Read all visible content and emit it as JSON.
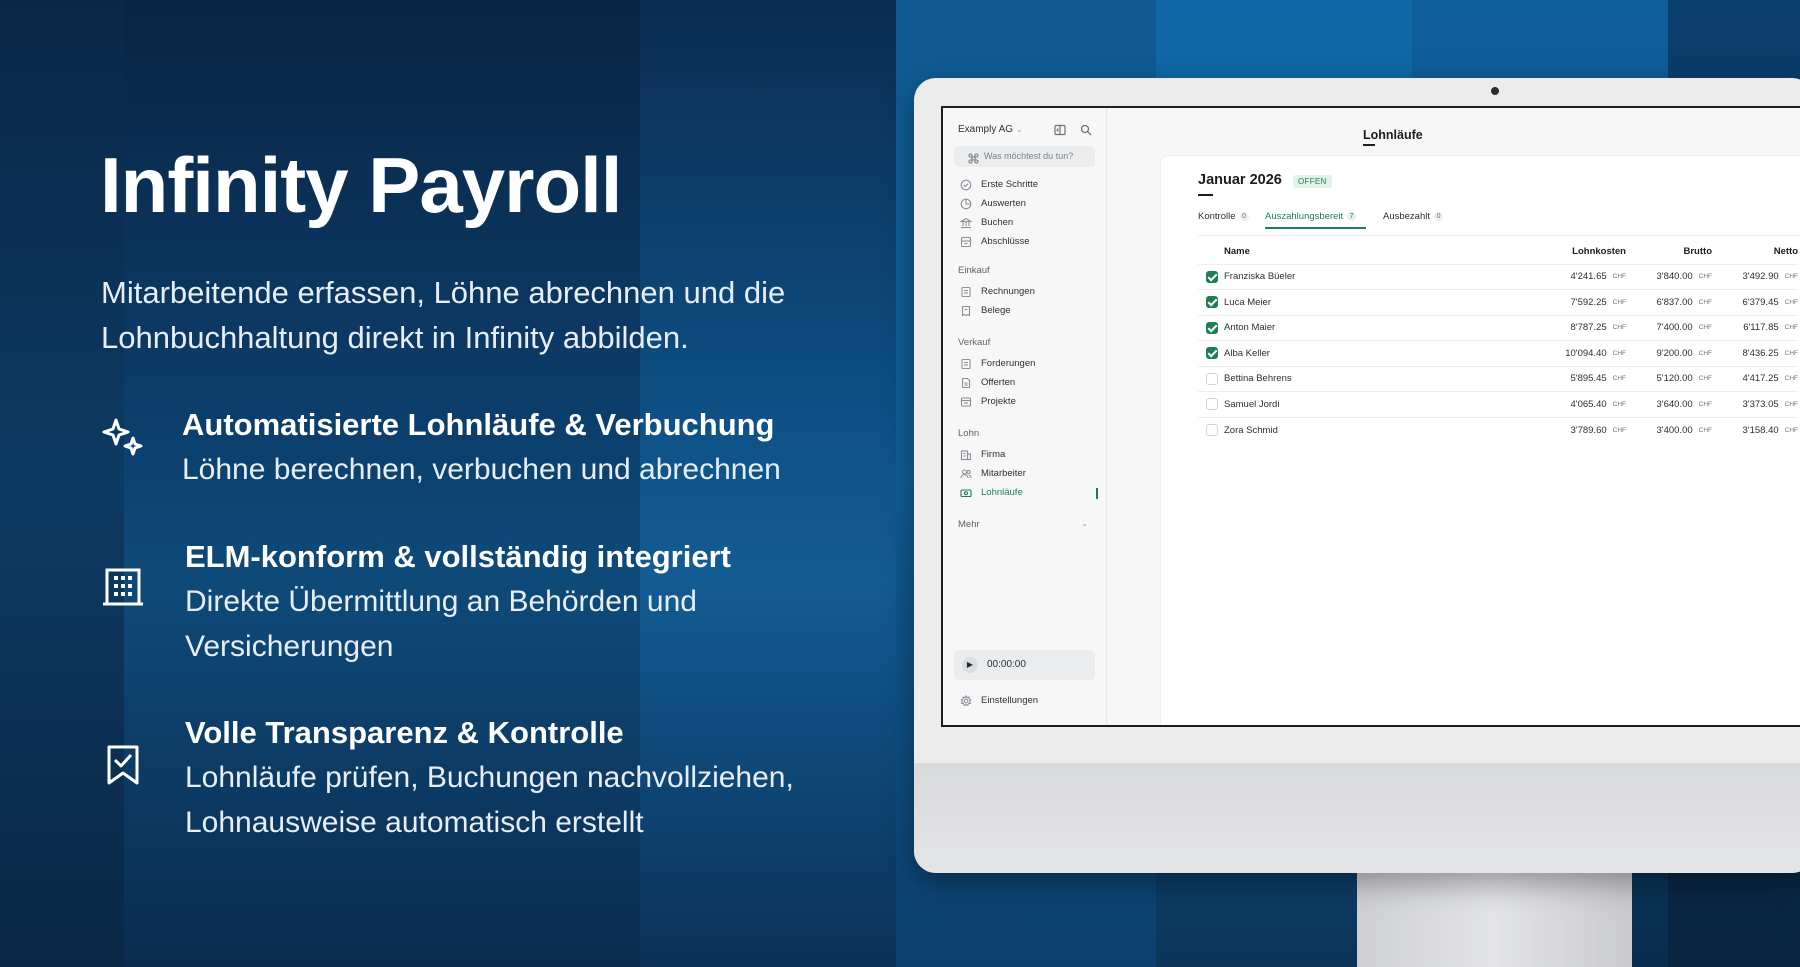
{
  "hero": {
    "title": "Infinity Payroll",
    "subtitle": "Mitarbeitende erfassen, Löhne abrechnen und die Lohnbuchhaltung direkt in Infinity abbilden."
  },
  "features": [
    {
      "icon": "sparkles-icon",
      "heading": "Automatisierte Lohnläufe & Verbuchung",
      "description": "Löhne berechnen, verbuchen und abrechnen"
    },
    {
      "icon": "building-icon",
      "heading": "ELM-konform & vollständig integriert",
      "description": "Direkte Übermittlung an Behörden und Versicherungen"
    },
    {
      "icon": "bookmark-check-icon",
      "heading": "Volle Transparenz & Kontrolle",
      "description": "Lohnläufe prüfen, Buchungen nachvollziehen, Lohnausweise automatisch erstellt"
    }
  ],
  "app": {
    "company": "Examply AG",
    "ask_placeholder": "Was möchtest du tun?",
    "nav_main": [
      {
        "label": "Erste Schritte",
        "icon": "check-circle-icon"
      },
      {
        "label": "Auswerten",
        "icon": "chart-icon"
      },
      {
        "label": "Buchen",
        "icon": "bank-icon"
      },
      {
        "label": "Abschlüsse",
        "icon": "archive-icon"
      }
    ],
    "sections": [
      {
        "title": "Einkauf",
        "items": [
          {
            "label": "Rechnungen",
            "icon": "invoice-icon"
          },
          {
            "label": "Belege",
            "icon": "receipt-icon"
          }
        ]
      },
      {
        "title": "Verkauf",
        "items": [
          {
            "label": "Forderungen",
            "icon": "invoice-icon"
          },
          {
            "label": "Offerten",
            "icon": "document-icon"
          },
          {
            "label": "Projekte",
            "icon": "folder-icon"
          }
        ]
      },
      {
        "title": "Lohn",
        "items": [
          {
            "label": "Firma",
            "icon": "building-icon"
          },
          {
            "label": "Mitarbeiter",
            "icon": "users-icon"
          },
          {
            "label": "Lohnläufe",
            "icon": "money-icon"
          }
        ]
      }
    ],
    "more_label": "Mehr",
    "timer": "00:00:00",
    "settings_label": "Einstellungen",
    "page_title": "Lohnläufe",
    "period": "Januar 2026",
    "period_status": "OFFEN",
    "tabs": [
      {
        "label": "Kontrolle",
        "count": "0"
      },
      {
        "label": "Auszahlungsbereit",
        "count": "7"
      },
      {
        "label": "Ausbezahlt",
        "count": "0"
      }
    ],
    "active_tab": "Auszahlungsbereit",
    "columns": {
      "name": "Name",
      "lohnkosten": "Lohnkosten",
      "brutto": "Brutto",
      "netto": "Netto"
    },
    "currency": "CHF",
    "rows": [
      {
        "checked": true,
        "name": "Franziska Büeler",
        "lohnkosten": "4'241.65",
        "brutto": "3'840.00",
        "netto": "3'492.90"
      },
      {
        "checked": true,
        "name": "Luca Meier",
        "lohnkosten": "7'592.25",
        "brutto": "6'837.00",
        "netto": "6'379.45"
      },
      {
        "checked": true,
        "name": "Anton Maier",
        "lohnkosten": "8'787.25",
        "brutto": "7'400.00",
        "netto": "6'117.85"
      },
      {
        "checked": true,
        "name": "Alba Keller",
        "lohnkosten": "10'094.40",
        "brutto": "9'200.00",
        "netto": "8'436.25"
      },
      {
        "checked": false,
        "name": "Bettina Behrens",
        "lohnkosten": "5'895.45",
        "brutto": "5'120.00",
        "netto": "4'417.25"
      },
      {
        "checked": false,
        "name": "Samuel Jordi",
        "lohnkosten": "4'065.40",
        "brutto": "3'640.00",
        "netto": "3'373.05"
      },
      {
        "checked": false,
        "name": "Zora Schmid",
        "lohnkosten": "3'789.60",
        "brutto": "3'400.00",
        "netto": "3'158.40"
      }
    ]
  },
  "colors": {
    "accent": "#1e7f55",
    "background": "#0b2340"
  }
}
